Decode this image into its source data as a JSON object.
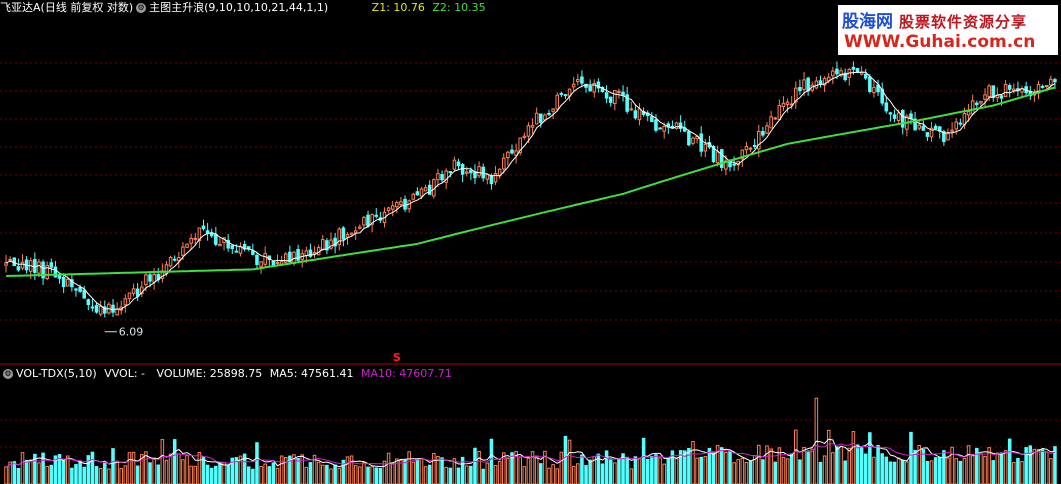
{
  "main_header": {
    "stock_name": "飞亚达A",
    "chart_mode": "(日线 前复权 对数)",
    "indicator": "主图主升浪",
    "params": "(9,10,10,10,21,44,1,1)",
    "z1_label": "Z1: 10.76",
    "z2_label": "Z2: 10.35"
  },
  "vol_header": {
    "indicator": "VOL-TDX",
    "params": "(5,10)",
    "vvol": "VVOL: -",
    "volume": "VOLUME: 25898.75",
    "ma5": "MA5: 47561.41",
    "ma10": "MA10: 47607.71"
  },
  "watermark": {
    "site": "股海网",
    "slogan": "股票软件资源分享",
    "url": "WWW.Guhai.com.cn"
  },
  "annotations": {
    "low_label": "6.09",
    "signal_marker": "S"
  },
  "colors": {
    "up": "#ff7f50",
    "down": "#54ffff",
    "slow_line": "#3ee03e",
    "fast_line": "#ffffff",
    "vol_ma10": "#d020d0",
    "grid": "#7a0000",
    "z1": "#e8e80a",
    "z2": "#3ee03e",
    "signal": "#ff2020"
  },
  "chart_data": [
    {
      "type": "candlestick",
      "title": "飞亚达A (日线 前复权 对数)",
      "ylim": [
        5.8,
        12.0
      ],
      "y_scale": "log",
      "grid": true,
      "anchors": [
        [
          0,
          7.05
        ],
        [
          12,
          6.9
        ],
        [
          24,
          6.3
        ],
        [
          36,
          6.85
        ],
        [
          48,
          7.55
        ],
        [
          60,
          7.15
        ],
        [
          72,
          7.1
        ],
        [
          86,
          7.7
        ],
        [
          100,
          8.15
        ],
        [
          110,
          8.75
        ],
        [
          118,
          8.45
        ],
        [
          128,
          9.55
        ],
        [
          138,
          10.45
        ],
        [
          148,
          10.15
        ],
        [
          156,
          9.65
        ],
        [
          164,
          9.4
        ],
        [
          176,
          8.65
        ],
        [
          186,
          9.6
        ],
        [
          196,
          10.55
        ],
        [
          206,
          10.75
        ],
        [
          218,
          9.6
        ],
        [
          228,
          9.25
        ],
        [
          238,
          10.2
        ],
        [
          248,
          10.3
        ],
        [
          255,
          10.55
        ]
      ],
      "num_candles": 256,
      "slow_ma": [
        [
          0,
          6.85
        ],
        [
          60,
          6.95
        ],
        [
          100,
          7.35
        ],
        [
          150,
          8.2
        ],
        [
          190,
          9.15
        ],
        [
          220,
          9.6
        ],
        [
          240,
          9.95
        ],
        [
          255,
          10.35
        ]
      ],
      "low_value": 6.09,
      "signal_index": 95
    },
    {
      "type": "bar",
      "title": "VOL-TDX (5,10)",
      "values": {
        "volume": 25898.75,
        "ma5": 47561.41,
        "ma10": 47607.71
      },
      "ylim": [
        0,
        120000
      ],
      "spike_indices": [
        197,
        244
      ]
    }
  ]
}
